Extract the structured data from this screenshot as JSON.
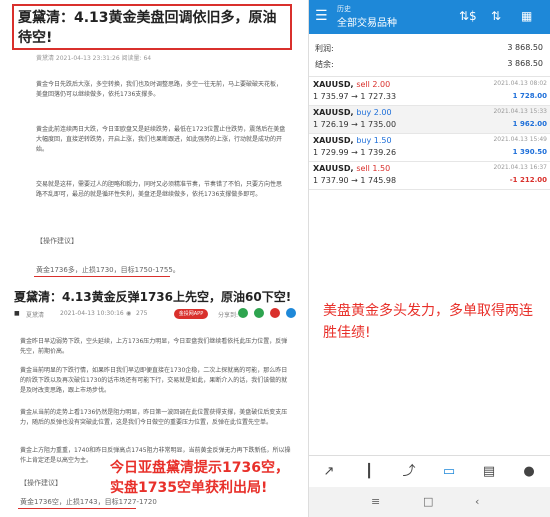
{
  "article1": {
    "title": "夏黛清：4.13黄金美盘回调依旧多，原油待空!",
    "meta": "黄黛清    2021-04-13 23:31:26  阅读量: 64",
    "para1": "黄金今日先跌后大涨，多空转换，我们也及时调整思路，多空一往无前，马上要破破天花板，美盘回落仍可以继续做多，依托1736支撑多。",
    "para2": "黄金此前连续两日大跌，今日亚欧盘又是延续跌势，最低在1723位置止住跌势，震荡后在美盘大幅度回，直接逆转跌势，开启上涨，我们也果断跟进，如此强势的上涨，行动就是成功的开始。",
    "para3": "交易就是这样，需要过人的胆略和毅力，同时又必须精准节奏，节奏错了不怕，只要方向性思路不乱即可，最忌的就是循环性失利，美盘还是继续做多，依托1736支撑做多即可。",
    "op_label": "【操作建议】",
    "op_text": "黄金1736多，止损1730，目标1750-1755。"
  },
  "article2": {
    "title": "夏黛清：4.13黄金反弹1736上先空，原油60下空!",
    "author": "夏黛清",
    "time": "2021-04-13 10:30:16",
    "views": "275",
    "pill": "金投网APP",
    "share_label": "分享到:",
    "para1": "黄金昨日早边弱势下跌，空头延续，上方1736压力明显，今日亚盘我们继续看依托此压力位置，反弹先空，前期价高。",
    "para2": "黄金当前明显的下跌行情，如果昨日我们早边即便直接在1730企稳，二次上探就高的可能，那么昨日的阶跌下跌以及再次破位1730的话市场还有可能下行，交易就是如此，果断介入的话，我们该做的就是及时改变思路，跟上市场步伐。",
    "para3": "黄金从当前的走势上看1736仍然是阻力明显，昨日第一波回调在此位置获得支撑，美盘破位后变支压力，随后的反弹也没有突破此位置，这是我们今日做空的重要压力位置，反弹在此位置先空单。",
    "para4": "黄金上方阻力重重，1740和昨日反弹高点1745阻力非常明显，当前黄金反弹无力再下跌新低，所以操作上肯定还是以高空为主。",
    "op_label": "【操作建议】",
    "op_text": "黄金1736空，止损1743，目标1727-1720"
  },
  "left_overlay": [
    "今日亚盘黛清提示1736空，",
    "实盘1735空单获利出局!"
  ],
  "app": {
    "header_small": "历史",
    "header_main": "全部交易品种",
    "profit_label": "利润:",
    "profit_value": "3 868.50",
    "balance_label": "结余:",
    "balance_value": "3 868.50",
    "positions": [
      {
        "symbol": "XAUUSD",
        "direction": "sell 2.00",
        "dir_type": "sell",
        "prices": "1 735.97 → 1 727.33",
        "time": "2021.04.13 08:02",
        "profit": "1 728.00",
        "profit_type": "up",
        "highlight": false
      },
      {
        "symbol": "XAUUSD",
        "direction": "buy 2.00",
        "dir_type": "buy",
        "prices": "1 726.19 → 1 735.00",
        "time": "2021.04.13 15:33",
        "profit": "1 962.00",
        "profit_type": "up",
        "highlight": true
      },
      {
        "symbol": "XAUUSD",
        "direction": "buy 1.50",
        "dir_type": "buy",
        "prices": "1 729.99 → 1 739.26",
        "time": "2021.04.13 15:49",
        "profit": "1 390.50",
        "profit_type": "up",
        "highlight": false
      },
      {
        "symbol": "XAUUSD",
        "direction": "sell 1.50",
        "dir_type": "sell",
        "prices": "1 737.90 → 1 745.98",
        "time": "2021.04.13 16:37",
        "profit": "-1 212.00",
        "profit_type": "dn",
        "highlight": false
      }
    ],
    "note": "美盘黄金多头发力，多单取得两连胜佳绩!",
    "colors": {
      "brand": "#1e88d8",
      "loss": "#d9302c",
      "gain": "#1e6fd9",
      "annotation": "#e8302a"
    }
  }
}
